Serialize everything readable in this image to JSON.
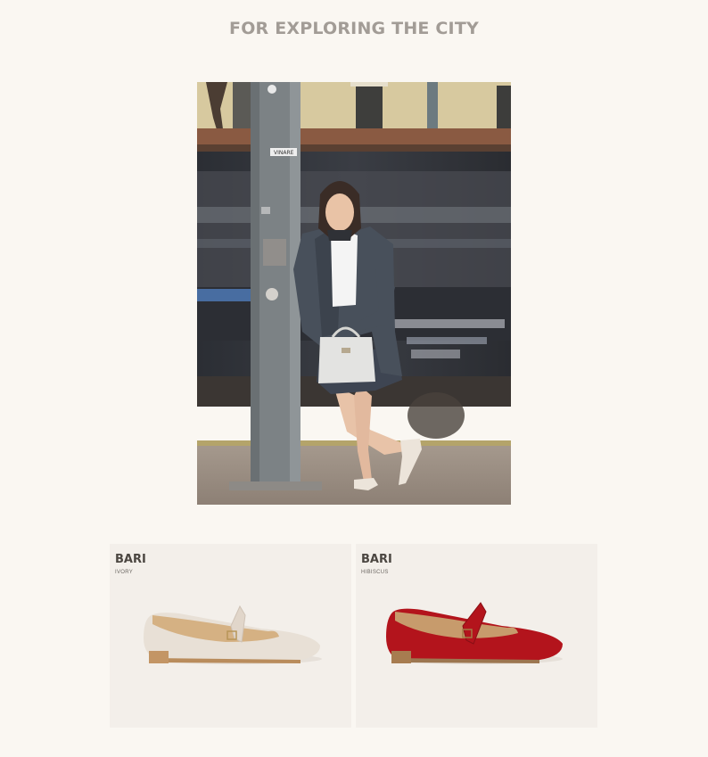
{
  "section": {
    "title": "FOR EXPLORING THE CITY"
  },
  "products": [
    {
      "name": "BARI",
      "variant": "IVORY",
      "color": "#e9e1d8"
    },
    {
      "name": "BARI",
      "variant": "HIBISCUS",
      "color": "#b3141c"
    }
  ],
  "hero": {
    "sign_text": "VINARE"
  }
}
